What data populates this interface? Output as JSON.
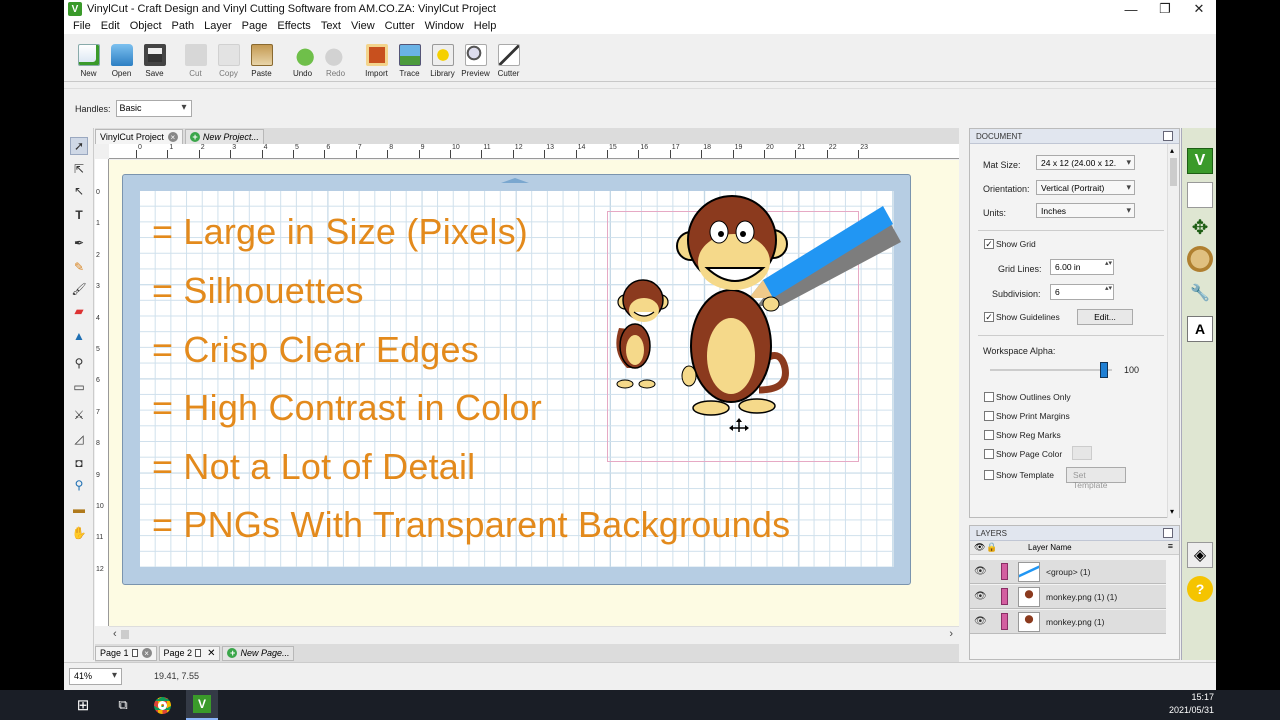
{
  "window": {
    "title": "VinylCut - Craft Design and Vinyl Cutting Software from AM.CO.ZA: VinylCut Project",
    "minimize": "—",
    "restore": "❐",
    "close": "✕"
  },
  "menu": [
    "File",
    "Edit",
    "Object",
    "Path",
    "Layer",
    "Page",
    "Effects",
    "Text",
    "View",
    "Cutter",
    "Window",
    "Help"
  ],
  "toolbar": [
    {
      "label": "New",
      "icon": "new-doc-icon",
      "enabled": true
    },
    {
      "label": "Open",
      "icon": "open-folder-icon",
      "enabled": true
    },
    {
      "label": "Save",
      "icon": "save-disk-icon",
      "enabled": true
    },
    {
      "label": "Cut",
      "icon": "scissors-icon",
      "enabled": false
    },
    {
      "label": "Copy",
      "icon": "copy-icon",
      "enabled": false
    },
    {
      "label": "Paste",
      "icon": "paste-icon",
      "enabled": true
    },
    {
      "label": "Undo",
      "icon": "undo-icon",
      "enabled": true
    },
    {
      "label": "Redo",
      "icon": "redo-icon",
      "enabled": false
    },
    {
      "label": "Import",
      "icon": "import-icon",
      "enabled": true
    },
    {
      "label": "Trace",
      "icon": "trace-icon",
      "enabled": true
    },
    {
      "label": "Library",
      "icon": "library-icon",
      "enabled": true
    },
    {
      "label": "Preview",
      "icon": "preview-icon",
      "enabled": true
    },
    {
      "label": "Cutter",
      "icon": "cutter-icon",
      "enabled": true
    }
  ],
  "options": {
    "handles_label": "Handles:",
    "handles_value": "Basic"
  },
  "doc_tabs": {
    "active": "VinylCut Project",
    "new": "New Project..."
  },
  "canvas": {
    "lessons": [
      "= Large in Size (Pixels)",
      "= Silhouettes",
      "= Crisp Clear Edges",
      "= High Contrast in Color",
      "= Not a Lot of Detail",
      "= PNGs With Transparent Backgrounds"
    ],
    "text_color": "#e38a1c"
  },
  "ruler_h": [
    "0",
    "1",
    "2",
    "3",
    "4",
    "5",
    "6",
    "7",
    "8",
    "9",
    "10",
    "11",
    "12",
    "13",
    "14",
    "15",
    "16",
    "17",
    "18",
    "19",
    "20",
    "21",
    "22",
    "23"
  ],
  "ruler_v": [
    "0",
    "1",
    "2",
    "3",
    "4",
    "5",
    "6",
    "7",
    "8",
    "9",
    "10",
    "11",
    "12"
  ],
  "page_tabs": {
    "page1": "Page 1",
    "page2": "Page 2",
    "new": "New Page..."
  },
  "status": {
    "zoom": "41%",
    "coords": "19.41, 7.55"
  },
  "document_panel": {
    "title": "DOCUMENT",
    "mat_size_label": "Mat Size:",
    "mat_size_value": "24 x 12 (24.00 x 12.",
    "orientation_label": "Orientation:",
    "orientation_value": "Vertical (Portrait)",
    "units_label": "Units:",
    "units_value": "Inches",
    "show_grid": "Show Grid",
    "grid_lines_label": "Grid Lines:",
    "grid_lines_value": "6.00 in",
    "subdivision_label": "Subdivision:",
    "subdivision_value": "6",
    "show_guidelines": "Show Guidelines",
    "edit_button": "Edit...",
    "workspace_alpha_label": "Workspace Alpha:",
    "workspace_alpha_value": "100",
    "show_outlines": "Show Outlines Only",
    "show_print_margins": "Show Print Margins",
    "show_reg_marks": "Show Reg Marks",
    "show_page_color": "Show Page Color",
    "show_template": "Show Template",
    "set_template": "Set Template"
  },
  "layers_panel": {
    "title": "LAYERS",
    "column_name": "Layer Name",
    "rows": [
      "<group> (1)",
      "monkey.png (1) (1)",
      "monkey.png (1)"
    ]
  },
  "taskbar": {
    "time": "15:17",
    "date": "2021/05/31"
  }
}
